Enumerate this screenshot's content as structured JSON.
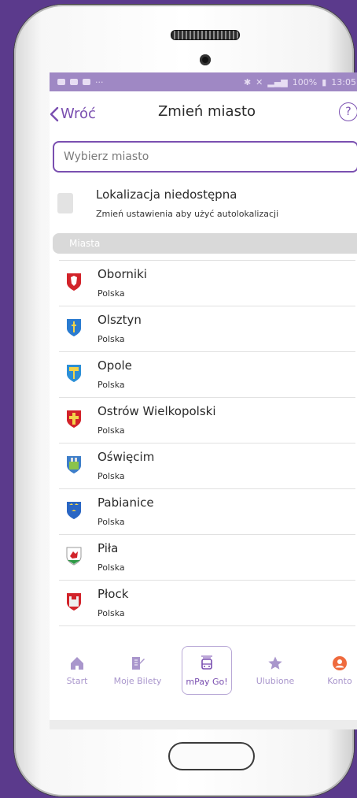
{
  "status_bar": {
    "battery": "100%",
    "time": "13:05"
  },
  "header": {
    "back_label": "Wróć",
    "title": "Zmień miasto",
    "help_symbol": "?"
  },
  "search": {
    "placeholder": "Wybierz miasto"
  },
  "location": {
    "title": "Lokalizacja niedostępna",
    "subtitle": "Zmień ustawienia aby użyć autolokalizacji"
  },
  "section_label": "Miasta",
  "cities": [
    {
      "name": "Oborniki",
      "country": "Polska"
    },
    {
      "name": "Olsztyn",
      "country": "Polska"
    },
    {
      "name": "Opole",
      "country": "Polska"
    },
    {
      "name": "Ostrów Wielkopolski",
      "country": "Polska"
    },
    {
      "name": "Oświęcim",
      "country": "Polska"
    },
    {
      "name": "Pabianice",
      "country": "Polska"
    },
    {
      "name": "Piła",
      "country": "Polska"
    },
    {
      "name": "Płock",
      "country": "Polska"
    }
  ],
  "tabs": {
    "start": "Start",
    "tickets": "Moje Bilety",
    "go": "mPay Go!",
    "favorites": "Ulubione",
    "account": "Konto"
  },
  "colors": {
    "accent": "#7a4fb0",
    "tab": "#a996cc",
    "account": "#ef6a3d"
  }
}
